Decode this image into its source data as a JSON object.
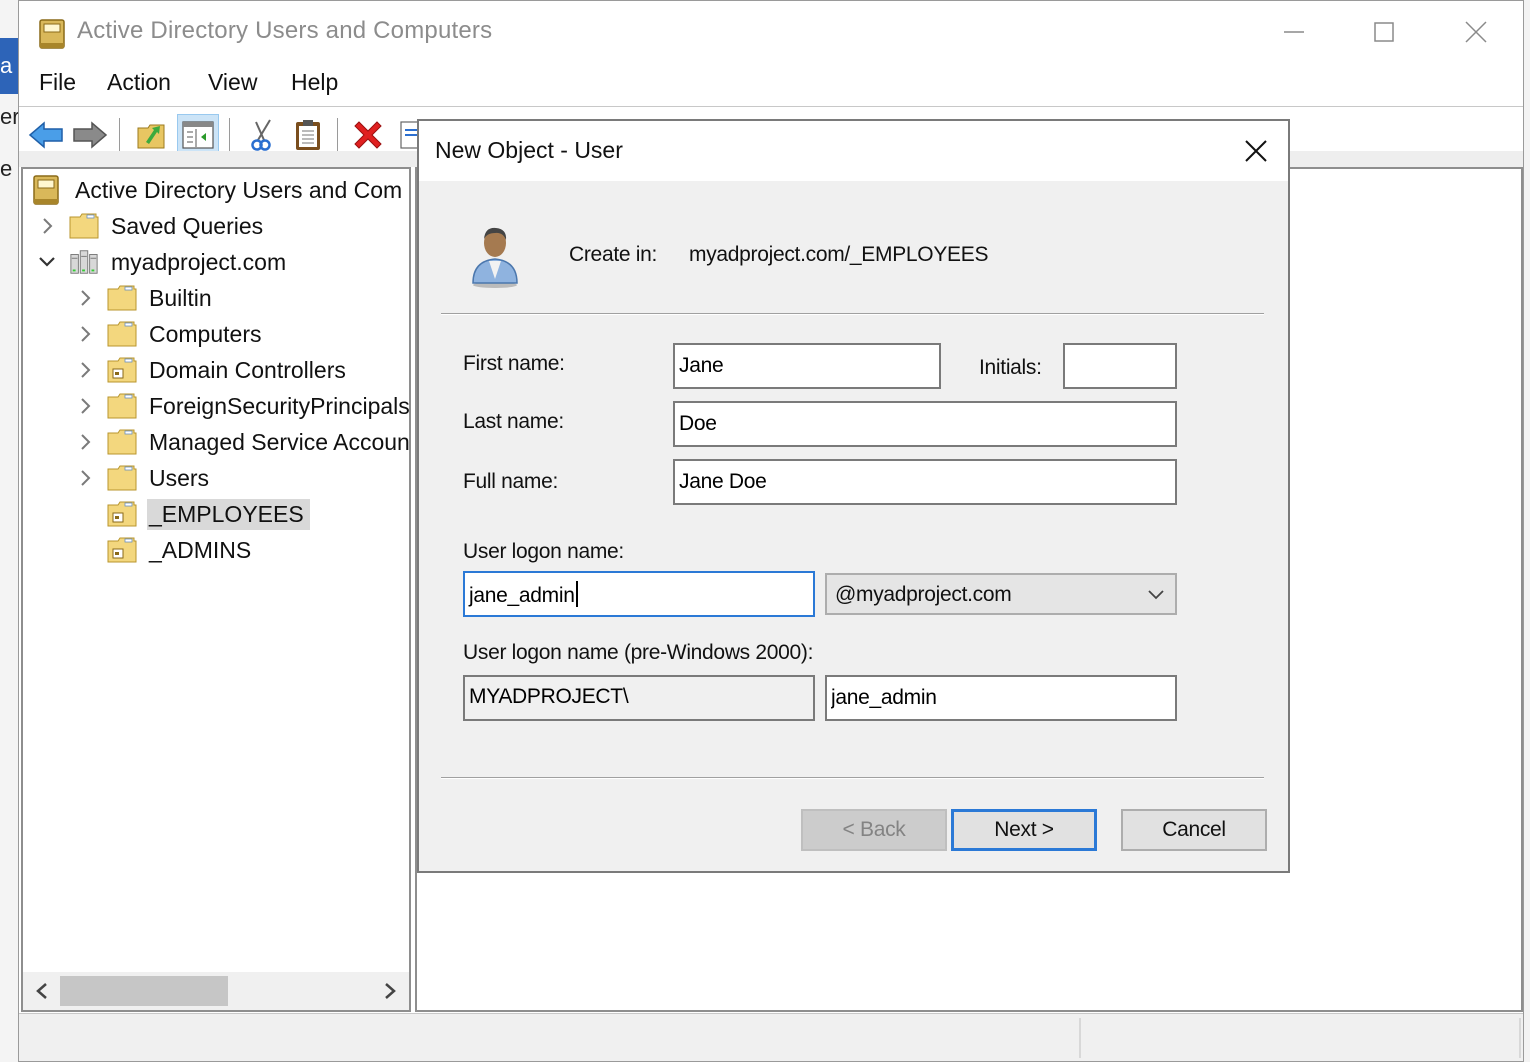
{
  "window": {
    "title": "Active Directory Users and Computers",
    "controls": {
      "minimize": "minimize",
      "maximize": "maximize",
      "close": "close"
    }
  },
  "menu": [
    "File",
    "Action",
    "View",
    "Help"
  ],
  "toolbar": {
    "buttons": [
      {
        "name": "back",
        "icon": "back-arrow-icon"
      },
      {
        "name": "forward",
        "icon": "forward-arrow-icon"
      },
      {
        "name": "up-one-level",
        "icon": "folder-up-icon"
      },
      {
        "name": "show-hide-console-tree",
        "icon": "console-tree-icon",
        "active": true
      },
      {
        "name": "cut",
        "icon": "scissors-icon"
      },
      {
        "name": "paste",
        "icon": "clipboard-icon"
      },
      {
        "name": "delete",
        "icon": "delete-x-icon"
      },
      {
        "name": "properties",
        "icon": "properties-icon"
      }
    ]
  },
  "tree": {
    "root": "Active Directory Users and Com",
    "items": [
      {
        "label": "Saved Queries",
        "level": 1,
        "expander": "collapsed",
        "icon": "folder"
      },
      {
        "label": "myadproject.com",
        "level": 1,
        "expander": "expanded",
        "icon": "domain"
      },
      {
        "label": "Builtin",
        "level": 2,
        "expander": "collapsed",
        "icon": "folder"
      },
      {
        "label": "Computers",
        "level": 2,
        "expander": "collapsed",
        "icon": "folder"
      },
      {
        "label": "Domain Controllers",
        "level": 2,
        "expander": "collapsed",
        "icon": "ou"
      },
      {
        "label": "ForeignSecurityPrincipals",
        "level": 2,
        "expander": "collapsed",
        "icon": "folder"
      },
      {
        "label": "Managed Service Accounts",
        "level": 2,
        "expander": "collapsed",
        "icon": "folder"
      },
      {
        "label": "Users",
        "level": 2,
        "expander": "collapsed",
        "icon": "folder"
      },
      {
        "label": "_EMPLOYEES",
        "level": 2,
        "expander": "none",
        "icon": "ou",
        "selected": true
      },
      {
        "label": "_ADMINS",
        "level": 2,
        "expander": "none",
        "icon": "ou"
      }
    ]
  },
  "dialog": {
    "title": "New Object - User",
    "create_in_label": "Create in:",
    "create_in_value": "myadproject.com/_EMPLOYEES",
    "fields": {
      "first_name": {
        "label": "First name:",
        "value": "Jane"
      },
      "initials": {
        "label": "Initials:",
        "value": ""
      },
      "last_name": {
        "label": "Last name:",
        "value": "Doe"
      },
      "full_name": {
        "label": "Full name:",
        "value": "Jane Doe"
      },
      "logon_name": {
        "label": "User logon name:",
        "value": "jane_admin"
      },
      "upn_suffix": {
        "selected": "@myadproject.com"
      },
      "pre2000_label": "User logon name (pre-Windows 2000):",
      "pre2000_domain": "MYADPROJECT\\",
      "pre2000_name": "jane_admin"
    },
    "buttons": {
      "back": "< Back",
      "next": "Next >",
      "cancel": "Cancel"
    }
  },
  "colors": {
    "focus_border": "#2b79d6",
    "selection": "#d9d9d9",
    "dialog_bg": "#f0f0f0"
  }
}
